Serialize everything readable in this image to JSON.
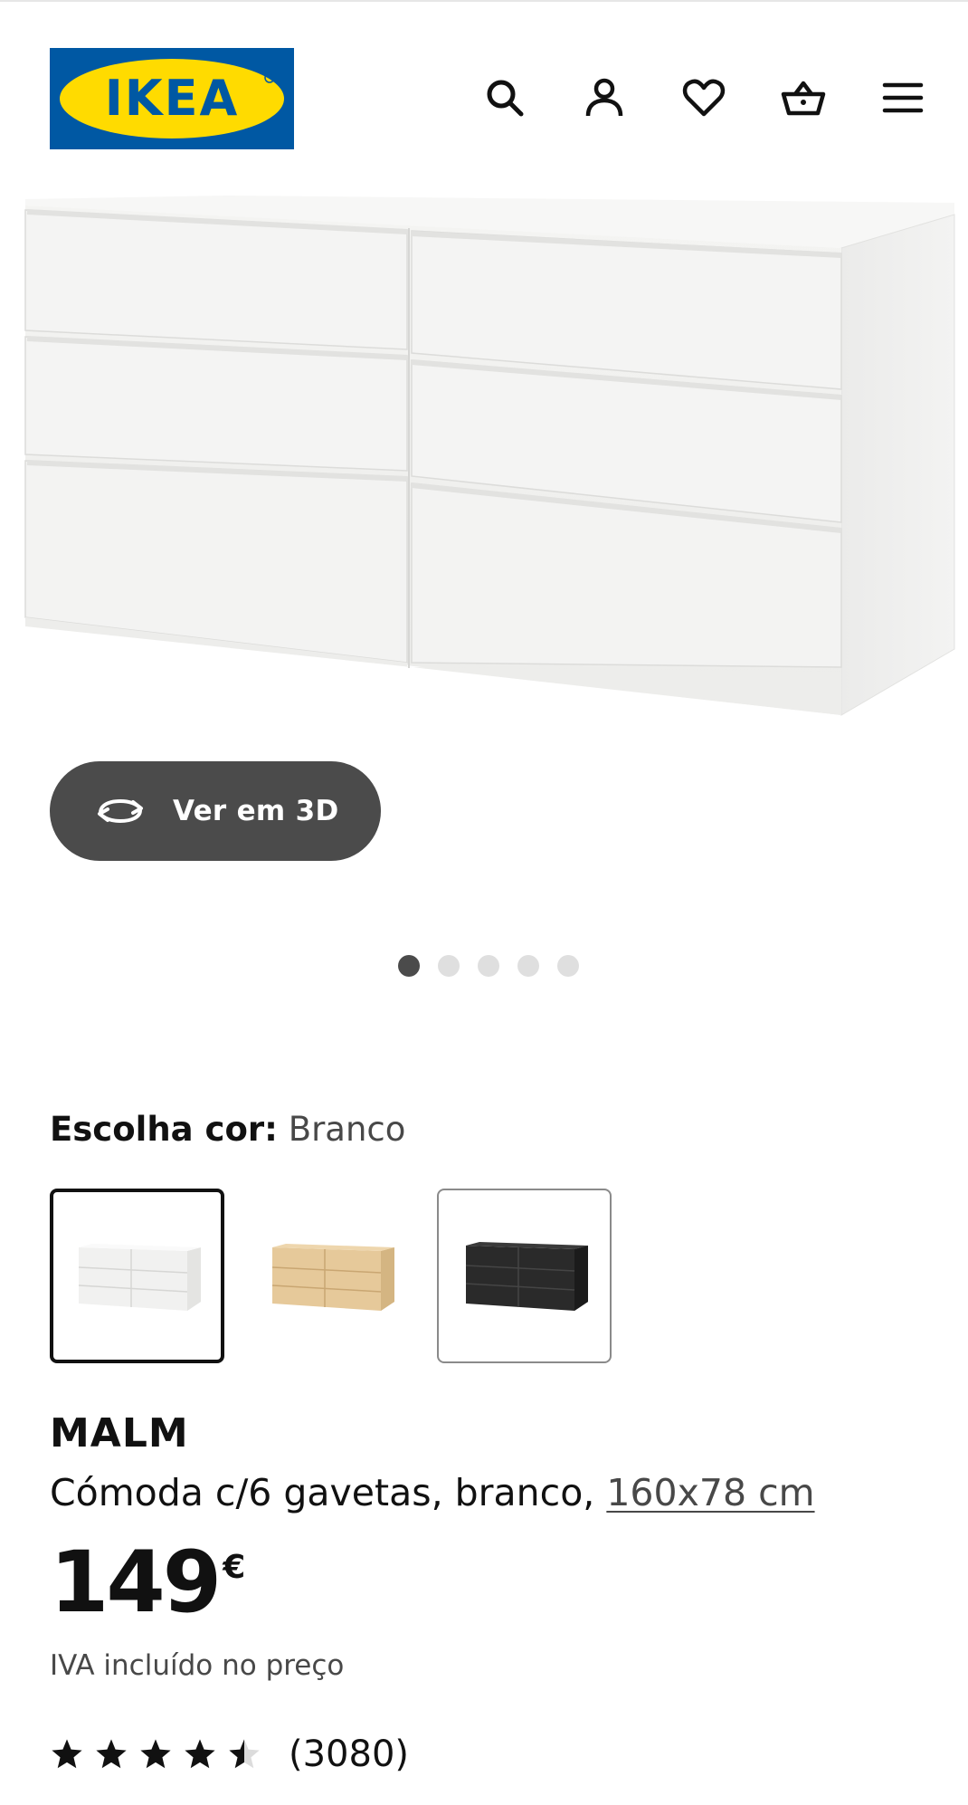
{
  "header": {
    "logo_text": "IKEA",
    "icons": [
      "search-icon",
      "user-icon",
      "heart-icon",
      "basket-icon",
      "menu-icon"
    ]
  },
  "hero": {
    "view3d_label": "Ver em 3D",
    "carousel_total": 5,
    "carousel_active": 1
  },
  "color": {
    "label": "Escolha cor:",
    "value": "Branco",
    "options": [
      "white",
      "oak-veneer",
      "black-brown"
    ],
    "selected_index": 0
  },
  "product": {
    "brand": "MALM",
    "description": "Cómoda c/6 gavetas, branco, ",
    "size_link": "160x78 cm",
    "price": "149",
    "currency": "€",
    "vat_note": "IVA incluído no preço",
    "rating": 4.5,
    "rating_count": "(3080)"
  },
  "colors": {
    "brand_blue": "#0058a3",
    "brand_yellow": "#ffdb00",
    "button_dark": "#4b4b4b"
  }
}
